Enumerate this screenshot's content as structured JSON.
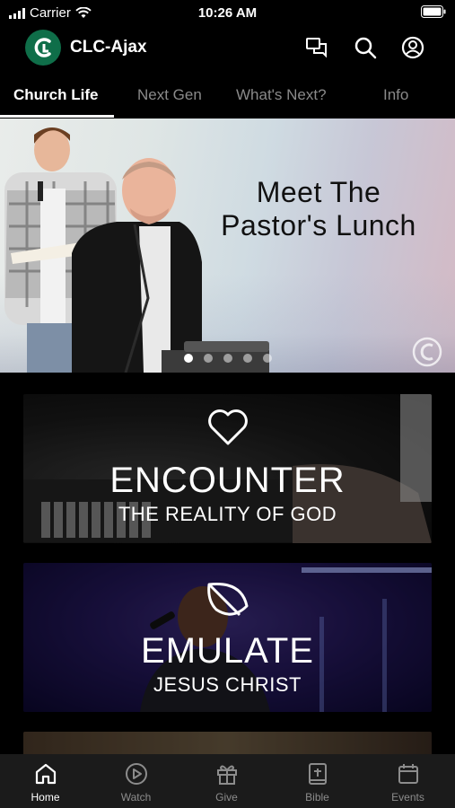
{
  "status_bar": {
    "carrier": "Carrier",
    "time": "10:26 AM"
  },
  "header": {
    "title": "CLC-Ajax"
  },
  "tabs": [
    {
      "label": "Church Life",
      "active": true
    },
    {
      "label": "Next Gen",
      "active": false
    },
    {
      "label": "What's Next?",
      "active": false
    },
    {
      "label": "Info",
      "active": false
    }
  ],
  "hero": {
    "title": "Meet The Pastor's Lunch",
    "slide_count": 5,
    "active_slide": 1
  },
  "cards": [
    {
      "title": "ENCOUNTER",
      "subtitle": "THE REALITY OF GOD",
      "icon": "heart-icon"
    },
    {
      "title": "EMULATE",
      "subtitle": "JESUS CHRIST",
      "icon": "leaf-icon"
    }
  ],
  "bottom_nav": [
    {
      "label": "Home",
      "icon": "home-icon",
      "active": true
    },
    {
      "label": "Watch",
      "icon": "play-icon",
      "active": false
    },
    {
      "label": "Give",
      "icon": "gift-icon",
      "active": false
    },
    {
      "label": "Bible",
      "icon": "bible-icon",
      "active": false
    },
    {
      "label": "Events",
      "icon": "calendar-icon",
      "active": false
    }
  ],
  "colors": {
    "brand": "#0f6e49",
    "background": "#000000",
    "nav_bg": "#1b1b1b",
    "inactive": "#8c8c8c"
  }
}
